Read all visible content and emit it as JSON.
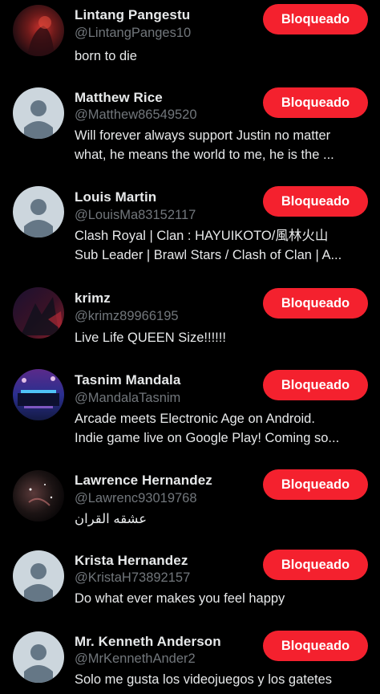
{
  "theme": {
    "background": "#000000",
    "text": "#e7e9ea",
    "muted": "#71767b",
    "block_button": "#f4212e",
    "default_avatar_bg": "#ccd6dd",
    "default_avatar_fg": "#657786"
  },
  "blocked_button_label": "Bloqueado",
  "users": [
    {
      "name": "Lintang Pangestu",
      "handle": "@LintangPanges10",
      "bio": [
        "born to die"
      ],
      "avatar": "photo-dark-red",
      "button": "Bloqueado"
    },
    {
      "name": "Matthew Rice",
      "handle": "@Matthew86549520",
      "bio": [
        "Will forever always support Justin no matter",
        "what, he means the world to me, he is the ..."
      ],
      "avatar": "default-avatar",
      "button": "Bloqueado"
    },
    {
      "name": "Louis Martin",
      "handle": "@LouisMa83152117",
      "bio": [
        "Clash Royal | Clan : HAYUIKOTO/風林火山",
        "Sub Leader | Brawl Stars / Clash of Clan | A..."
      ],
      "avatar": "default-avatar",
      "button": "Bloqueado"
    },
    {
      "name": "krimz",
      "handle": "@krimz89966195",
      "bio": [
        "Live Life QUEEN Size!!!!!!"
      ],
      "avatar": "photo-dark-figure",
      "button": "Bloqueado"
    },
    {
      "name": "Tasnim Mandala",
      "handle": "@MandalaTasnim",
      "bio": [
        "Arcade meets Electronic Age on Android.",
        "Indie game live on Google Play! Coming so..."
      ],
      "avatar": "photo-blue-purple-arena",
      "button": "Bloqueado"
    },
    {
      "name": "Lawrence Hernandez",
      "handle": "@Lawrenc93019768",
      "bio": [
        "عشقه القران"
      ],
      "avatar": "photo-dark-space",
      "button": "Bloqueado"
    },
    {
      "name": "Krista Hernandez",
      "handle": "@KristaH73892157",
      "bio": [
        "Do what ever makes you feel happy"
      ],
      "avatar": "default-avatar",
      "button": "Bloqueado"
    },
    {
      "name": "Mr. Kenneth Anderson",
      "handle": "@MrKennethAnder2",
      "bio": [
        "Solo me gusta los videojuegos y los gatetes"
      ],
      "avatar": "default-avatar",
      "button": "Bloqueado"
    }
  ]
}
